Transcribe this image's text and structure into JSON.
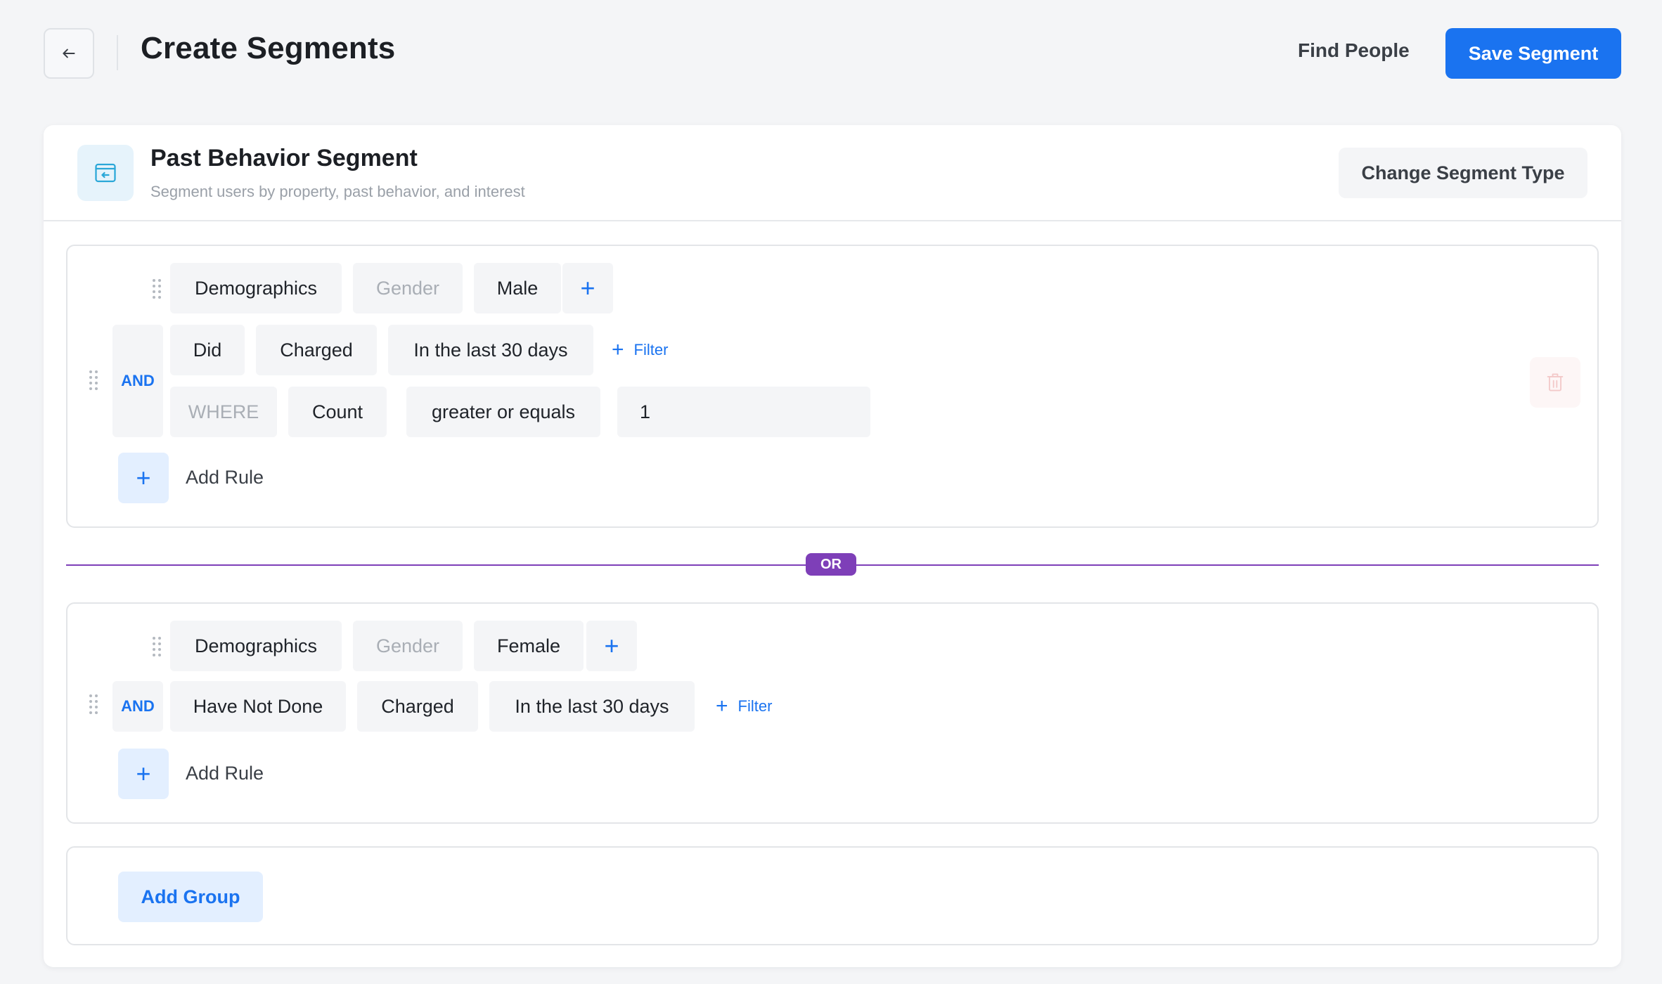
{
  "header": {
    "title": "Create Segments",
    "find_people_label": "Find People",
    "save_label": "Save Segment"
  },
  "segment": {
    "title": "Past Behavior Segment",
    "subtitle": "Segment users by property, past behavior, and interest",
    "change_type_label": "Change Segment Type"
  },
  "groups": [
    {
      "property_row": {
        "category": "Demographics",
        "field": "Gender",
        "value": "Male",
        "add_symbol": "+"
      },
      "connector": "AND",
      "event_row": {
        "action": "Did",
        "event": "Charged",
        "timeframe": "In the last 30 days",
        "filter_label": "Filter"
      },
      "where_row": {
        "keyword": "WHERE",
        "metric": "Count",
        "operator": "greater or equals",
        "value": "1"
      },
      "add_rule_label": "Add Rule"
    },
    {
      "property_row": {
        "category": "Demographics",
        "field": "Gender",
        "value": "Female",
        "add_symbol": "+"
      },
      "connector": "AND",
      "event_row": {
        "action": "Have Not Done",
        "event": "Charged",
        "timeframe": "In the last 30 days",
        "filter_label": "Filter"
      },
      "add_rule_label": "Add Rule"
    }
  ],
  "group_connector": "OR",
  "add_group_label": "Add Group",
  "add_symbol": "+",
  "colors": {
    "primary": "#1a73f0",
    "or_connector": "#7e3fb8",
    "chip_bg": "#f4f5f7",
    "page_bg": "#f4f5f7"
  }
}
